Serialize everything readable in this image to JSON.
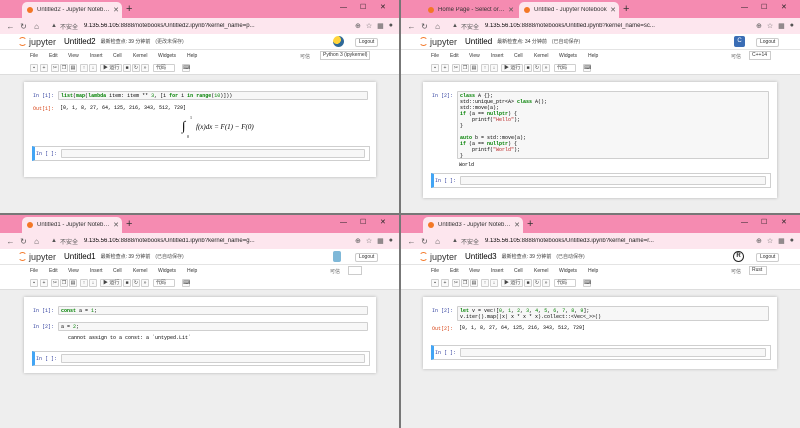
{
  "windows": [
    {
      "tabs": [
        {
          "label": "Untitled2 - Jupyter Notebook",
          "active": true
        }
      ],
      "url_status": "不安全",
      "url_host": "9.135.56.105",
      "url_rest": ":8888/notebooks/Untitled2.ipynb?kernel_name=p...",
      "notebook_name": "Untitled2",
      "checkpoint": "最新检查点: 39 分钟前",
      "save_status": "(更改未保存)",
      "logout": "Logout",
      "trusted": "可信",
      "kernel": "Python 3 (ipykernel)",
      "run": "▶ 运行",
      "cell_type": "代码",
      "cells": [
        {
          "in": "In  [1]:",
          "code": "list(map(lambda item: item ** 3, [i for i in range(10)]))",
          "out": "Out[1]:",
          "result": "[0, 1, 8, 27, 64, 125, 216, 343, 512, 729]"
        },
        {
          "in": "In  [ ]:"
        }
      ],
      "math": "f(x)dx = F(1) − F(0)",
      "math_lower": "0",
      "math_upper": "1"
    },
    {
      "tabs": [
        {
          "label": "Home Page - Select or create a...",
          "active": false
        },
        {
          "label": "Untitled - Jupyter Notebook",
          "active": true
        }
      ],
      "url_status": "不安全",
      "url_host": "9.135.56.105",
      "url_rest": ":8888/notebooks/Untitled.ipynb?kernel_name=sc...",
      "notebook_name": "Untitled",
      "checkpoint": "最新检查点: 34 分钟前",
      "save_status": "(已自动保存)",
      "logout": "Logout",
      "trusted": "可信",
      "kernel": "C++14",
      "run": "▶ 运行",
      "cell_type": "代码",
      "cells": [
        {
          "in": "In  [2]:",
          "code_lines": [
            "class A {};",
            "std::unique_ptr<A> class A();",
            "std::move(a);",
            "if (a == nullptr) {",
            "    printf(\"Hello\");",
            "}",
            "",
            "auto b = std::move(a);",
            "if (a == nullptr) {",
            "    printf(\"World\");",
            "}"
          ],
          "result": "World"
        },
        {
          "in": "In  [ ]:"
        }
      ]
    },
    {
      "tabs": [
        {
          "label": "Untitled1 - Jupyter Notebook",
          "active": true
        }
      ],
      "url_status": "不安全",
      "url_host": "9.135.56.105",
      "url_rest": ":8888/notebooks/Untitled1.ipynb?kernel_name=g...",
      "notebook_name": "Untitled1",
      "checkpoint": "最新检查点: 39 分钟前",
      "save_status": "(已自动保存)",
      "logout": "Logout",
      "trusted": "可信",
      "kernel": "",
      "run": "▶ 运行",
      "cell_type": "代码",
      "cells": [
        {
          "in": "In  [1]:",
          "code": "const a = 1;"
        },
        {
          "in": "In  [2]:",
          "code": "a = 2;",
          "error": "cannot assign to a const: a `untyped.Lit`"
        },
        {
          "in": "In  [ ]:"
        }
      ]
    },
    {
      "tabs": [
        {
          "label": "Untitled3 - Jupyter Notebook",
          "active": true
        }
      ],
      "url_status": "不安全",
      "url_host": "9.135.56.105",
      "url_rest": ":8888/notebooks/Untitled3.ipynb?kernel_name=r...",
      "notebook_name": "Untitled3",
      "checkpoint": "最新检查点: 39 分钟前",
      "save_status": "(已自动保存)",
      "logout": "Logout",
      "trusted": "可信",
      "kernel": "Rust",
      "run": "▶ 运行",
      "cell_type": "代码",
      "cells": [
        {
          "in": "In  [2]:",
          "code_lines": [
            "let v = vec![0, 1, 2, 3, 4, 5, 6, 7, 8, 9];",
            "v.iter().map(|x| x * x * x).collect::<Vec<_>>()"
          ],
          "out": "Out[2]:",
          "result": "[0, 1, 8, 27, 64, 125, 216, 343, 512, 729]"
        },
        {
          "in": "In  [ ]:"
        }
      ]
    }
  ],
  "menu": [
    "File",
    "Edit",
    "View",
    "Insert",
    "Cell",
    "Kernel",
    "Widgets",
    "Help"
  ],
  "brand": "jupyter",
  "colors": {
    "tabbar": "#f58bb1",
    "addrbar": "#fde6ee",
    "jupyter_orange": "#f37726",
    "cell_select": "#42a5f5"
  }
}
